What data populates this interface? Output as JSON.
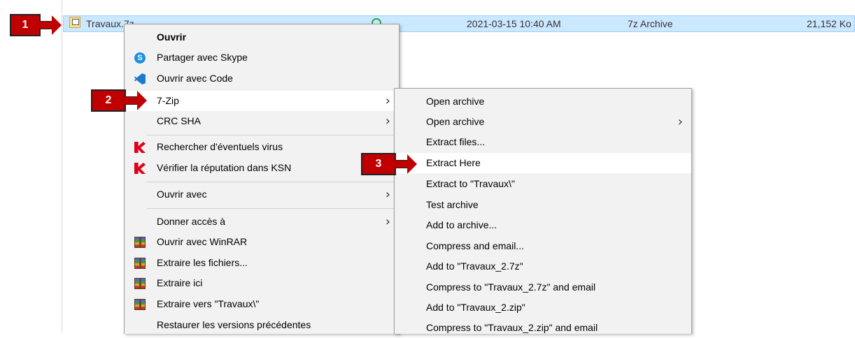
{
  "file": {
    "name": "Travaux.7z",
    "date": "2021-03-15 10:40 AM",
    "type": "7z Archive",
    "size": "21,152 Ko"
  },
  "context_menu": {
    "items": [
      {
        "label": "Ouvrir",
        "bold": true
      },
      {
        "label": "Partager avec Skype",
        "icon": "skype-icon"
      },
      {
        "label": "Ouvrir avec Code",
        "icon": "vscode-icon"
      },
      {
        "label": "7-Zip",
        "submenu": true,
        "highlighted": true
      },
      {
        "label": "CRC SHA",
        "submenu": true
      },
      {
        "label": "Rechercher d'éventuels virus",
        "icon": "kaspersky-icon"
      },
      {
        "label": "Vérifier la réputation dans KSN",
        "icon": "kaspersky-icon"
      },
      {
        "label": "Ouvrir avec",
        "submenu": true
      },
      {
        "label": "Donner accès à",
        "submenu": true
      },
      {
        "label": "Ouvrir avec WinRAR",
        "icon": "winrar-icon"
      },
      {
        "label": "Extraire les fichiers...",
        "icon": "winrar-icon"
      },
      {
        "label": "Extraire ici",
        "icon": "winrar-icon"
      },
      {
        "label": "Extraire vers \"Travaux\\\"",
        "icon": "winrar-icon"
      },
      {
        "label": "Restaurer les versions précédentes"
      }
    ]
  },
  "submenu_7zip": {
    "items": [
      {
        "label": "Open archive"
      },
      {
        "label": "Open archive",
        "submenu": true
      },
      {
        "label": "Extract files..."
      },
      {
        "label": "Extract Here",
        "highlighted": true
      },
      {
        "label": "Extract to \"Travaux\\\""
      },
      {
        "label": "Test archive"
      },
      {
        "label": "Add to archive..."
      },
      {
        "label": "Compress and email..."
      },
      {
        "label": "Add to \"Travaux_2.7z\""
      },
      {
        "label": "Compress to \"Travaux_2.7z\" and email"
      },
      {
        "label": "Add to \"Travaux_2.zip\""
      },
      {
        "label": "Compress to \"Travaux_2.zip\" and email"
      }
    ]
  },
  "callouts": [
    "1",
    "2",
    "3"
  ],
  "colors": {
    "callout": "#c00000",
    "selection": "#cce8ff",
    "menu_bg": "#f2f2f2"
  }
}
